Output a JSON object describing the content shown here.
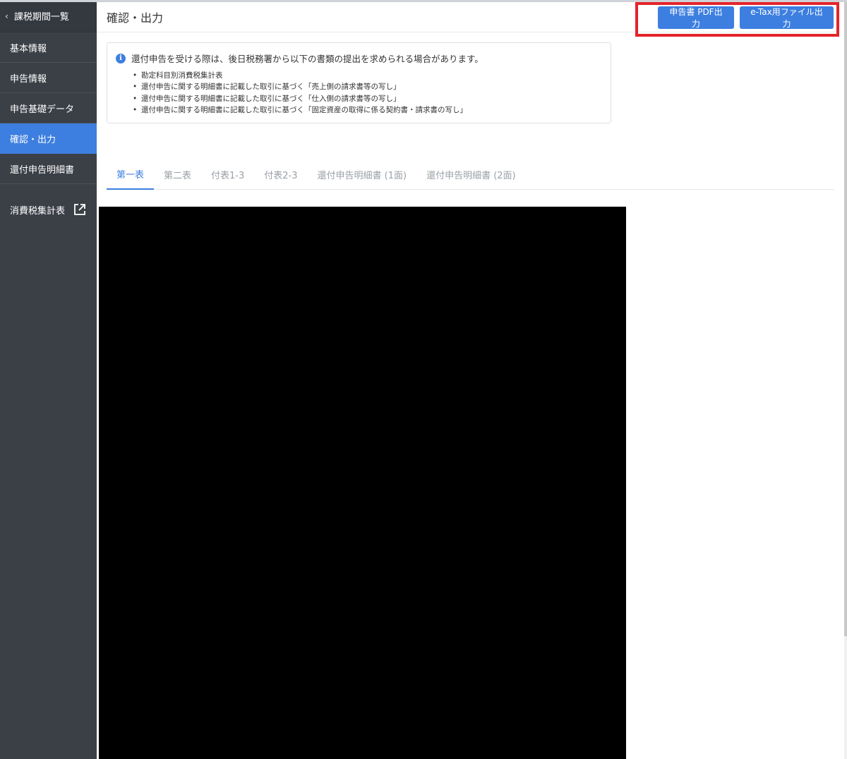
{
  "sidebar": {
    "back_label": "課税期間一覧",
    "items": [
      {
        "label": "基本情報"
      },
      {
        "label": "申告情報"
      },
      {
        "label": "申告基礎データ"
      },
      {
        "label": "確認・出力"
      },
      {
        "label": "還付申告明細書"
      }
    ],
    "external_label": "消費税集計表"
  },
  "header": {
    "title": "確認・出力",
    "pdf_button": "申告書 PDF出力",
    "etax_button": "e-Tax用ファイル出力"
  },
  "info": {
    "message": "還付申告を受ける際は、後日税務署から以下の書類の提出を求められる場合があります。",
    "items": [
      "勘定科目別消費税集計表",
      "還付申告に関する明細書に記載した取引に基づく「売上側の請求書等の写し」",
      "還付申告に関する明細書に記載した取引に基づく「仕入側の請求書等の写し」",
      "還付申告に関する明細書に記載した取引に基づく「固定資産の取得に係る契約書・請求書の写し」"
    ]
  },
  "tabs": [
    {
      "label": "第一表"
    },
    {
      "label": "第二表"
    },
    {
      "label": "付表1-3"
    },
    {
      "label": "付表2-3"
    },
    {
      "label": "還付申告明細書 (1面)"
    },
    {
      "label": "還付申告明細書 (2面)"
    }
  ],
  "colors": {
    "accent": "#3d7fe0",
    "sidebar_bg": "#3b4047",
    "highlight": "#e4242a"
  }
}
